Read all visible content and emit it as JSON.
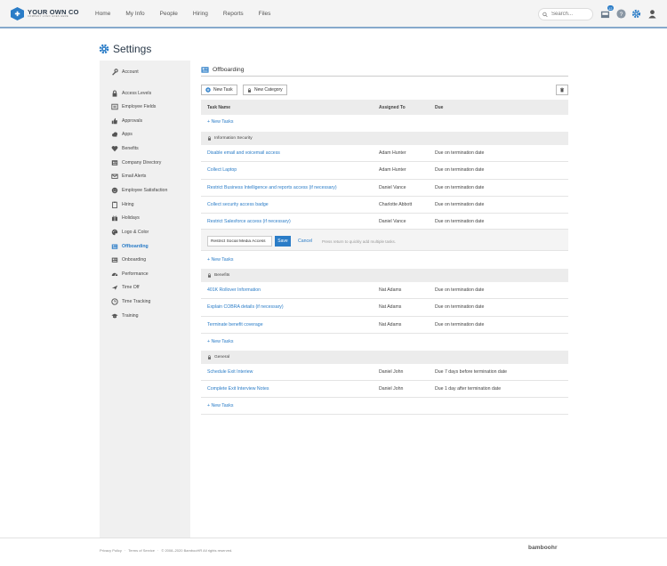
{
  "brand": {
    "logo_main": "YOUR OWN CO",
    "logo_sub": "COMPANY LOGO GOES HERE"
  },
  "nav": [
    "Home",
    "My Info",
    "People",
    "Hiring",
    "Reports",
    "Files"
  ],
  "search": {
    "placeholder": "Search..."
  },
  "header_icons": {
    "inbox_count": "12",
    "inbox": "inbox-icon",
    "help": "help-icon",
    "settings": "gear-icon",
    "profile": "user-icon"
  },
  "page": {
    "title": "Settings"
  },
  "sidebar": [
    {
      "label": "Account",
      "icon": "wrench-icon"
    },
    {
      "label": "Access Levels",
      "icon": "lock-icon"
    },
    {
      "label": "Employee Fields",
      "icon": "fields-icon"
    },
    {
      "label": "Approvals",
      "icon": "thumbs-up-icon"
    },
    {
      "label": "Apps",
      "icon": "cloud-icon"
    },
    {
      "label": "Benefits",
      "icon": "heart-icon"
    },
    {
      "label": "Company Directory",
      "icon": "directory-icon"
    },
    {
      "label": "Email Alerts",
      "icon": "envelope-icon"
    },
    {
      "label": "Employee Satisfaction",
      "icon": "smile-icon"
    },
    {
      "label": "Hiring",
      "icon": "clipboard-icon"
    },
    {
      "label": "Holidays",
      "icon": "gift-icon"
    },
    {
      "label": "Logo & Color",
      "icon": "palette-icon"
    },
    {
      "label": "Offboarding",
      "icon": "offboarding-icon",
      "active": true
    },
    {
      "label": "Onboarding",
      "icon": "onboarding-icon"
    },
    {
      "label": "Performance",
      "icon": "gauge-icon"
    },
    {
      "label": "Time Off",
      "icon": "plane-icon"
    },
    {
      "label": "Time Tracking",
      "icon": "clock-icon"
    },
    {
      "label": "Training",
      "icon": "graduation-cap-icon"
    }
  ],
  "main": {
    "section_title": "Offboarding",
    "new_task": "New Task",
    "new_category": "New Category",
    "columns": {
      "task": "Task Name",
      "assigned": "Assigned To",
      "due": "Due"
    },
    "add_tasks": "+ New Tasks",
    "categories": [
      {
        "name": "Information Security",
        "tasks": [
          {
            "name": "Disable email and voicemail access",
            "assigned": "Adam Hunter",
            "due": "Due on termination date"
          },
          {
            "name": "Collect Laptop",
            "assigned": "Adam Hunter",
            "due": "Due on termination date"
          },
          {
            "name": "Restrict Business Intelligence and reports access (if necessary)",
            "assigned": "Daniel Vance",
            "due": "Due on termination date"
          },
          {
            "name": "Collect security access badge",
            "assigned": "Charlotte Abbott",
            "due": "Due on termination date"
          },
          {
            "name": "Restrict Salesforce access (if necessary)",
            "assigned": "Daniel Vance",
            "due": "Due on termination date"
          }
        ]
      },
      {
        "name": "Benefits",
        "tasks": [
          {
            "name": "401K Rollover Information",
            "assigned": "Nat Adams",
            "due": "Due on termination date"
          },
          {
            "name": "Explain COBRA details (if necessary)",
            "assigned": "Nat Adams",
            "due": "Due on termination date"
          },
          {
            "name": "Terminate benefit coverage",
            "assigned": "Nat Adams",
            "due": "Due on termination date"
          }
        ]
      },
      {
        "name": "General",
        "tasks": [
          {
            "name": "Schedule Exit Interiew",
            "assigned": "Daniel John",
            "due": "Due 7 days before termination date"
          },
          {
            "name": "Complete Exit Interview Notes",
            "assigned": "Daniel John",
            "due": "Due 1 day after termination date"
          }
        ]
      }
    ],
    "entry": {
      "value": "Restrict Social Media Access",
      "save": "Save",
      "cancel": "Cancel",
      "hint": "Press return to quickly add multiple tasks."
    }
  },
  "footer": {
    "privacy": "Privacy Policy",
    "sep": "·",
    "terms": "Terms of Service",
    "copyright": "© 2008–2020 BambooHR All rights reserved.",
    "brand": "bamboohr"
  },
  "colors": {
    "accent": "#2a7cc7",
    "topbar": "#f4f4f4",
    "sidebar": "#f0f0f0"
  }
}
